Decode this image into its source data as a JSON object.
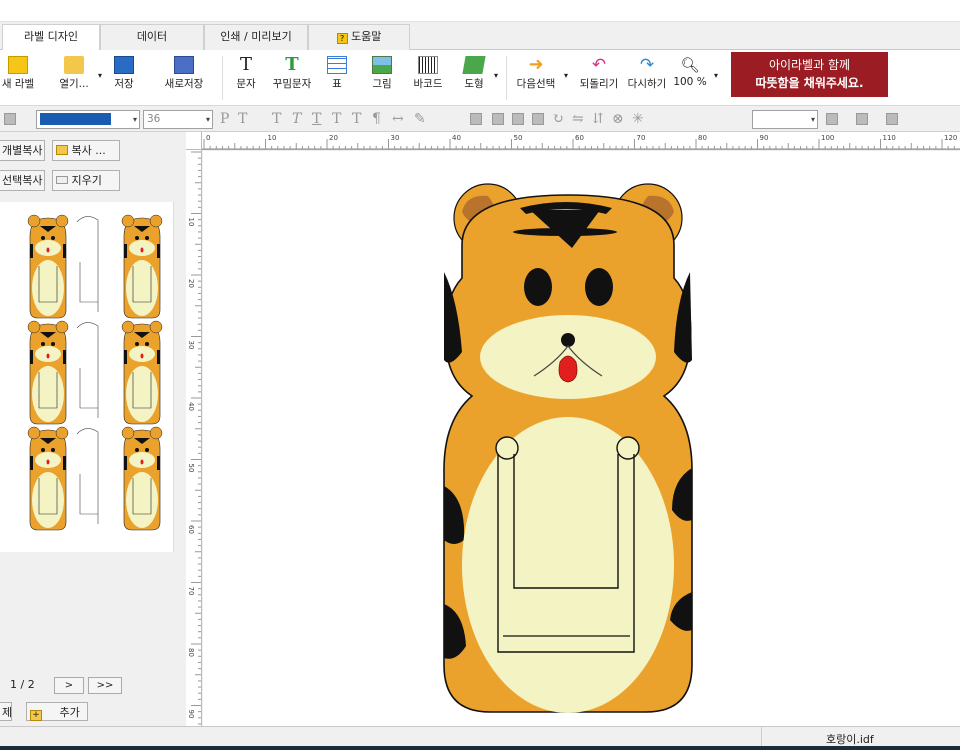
{
  "tabs": [
    "라벨 디자인",
    "데이터",
    "인쇄 / 미리보기",
    "도움말"
  ],
  "ribbon": {
    "new_label": "새 라벨",
    "open": "열기...",
    "save": "저장",
    "save_as": "새로저장",
    "text": "문자",
    "fancy_text": "꾸밈문자",
    "table": "표",
    "image": "그림",
    "barcode": "바코드",
    "shape": "도형",
    "next_select": "다음선택",
    "undo": "되돌리기",
    "redo": "다시하기",
    "zoom": "100 %"
  },
  "banner": {
    "line1": "아이라벨과 함께",
    "line2": "따뜻함을 채워주세요."
  },
  "format": {
    "font_size": "36"
  },
  "left": {
    "copy_each": "개별복사",
    "copy": "복사 ...",
    "copy_selected": "선택복사",
    "erase": "지우기",
    "page": "1 / 2",
    "next": ">",
    "last": ">>",
    "delete": "제",
    "add": "추가"
  },
  "ruler": {
    "top_ticks": [
      "0",
      "10",
      "20",
      "30",
      "40",
      "50",
      "60",
      "70",
      "80",
      "90",
      "100",
      "110",
      "120"
    ],
    "left_ticks": [
      "10",
      "20",
      "30",
      "40",
      "50",
      "60",
      "70",
      "80",
      "90"
    ]
  },
  "status": {
    "filename": "호랑이.idf"
  },
  "colors": {
    "tiger_orange": "#eba22c",
    "tiger_cream": "#f4f3c3",
    "tiger_stripe": "#111111",
    "tiger_ear": "#b8742c",
    "tongue": "#e21f1f",
    "banner": "#9b1c22",
    "active_tab": "#ffffff"
  }
}
